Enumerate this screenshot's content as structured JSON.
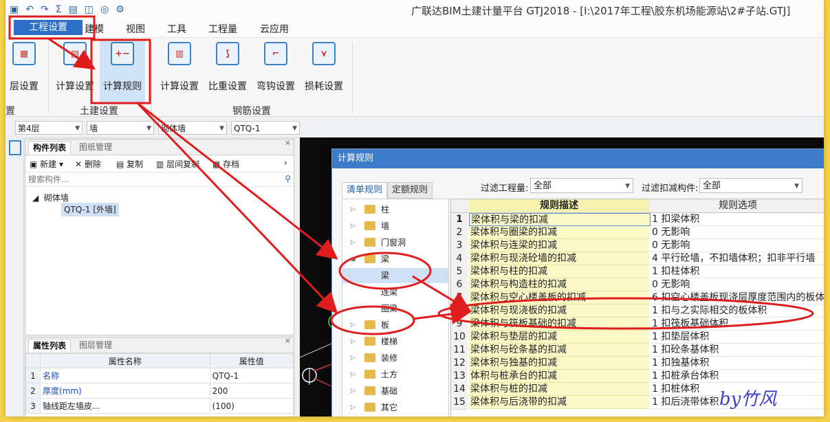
{
  "window": {
    "title": "广联达BIM土建计量平台 GTJ2018 - [I:\\2017年工程\\胶东机场能源站\\2#子站.GTJ]"
  },
  "menu": [
    "工程设置",
    "建模",
    "视图",
    "工具",
    "工程量",
    "云应用"
  ],
  "ribbon": {
    "buttons": [
      "层设置",
      "计算设置",
      "计算规则",
      "计算设置",
      "比重设置",
      "弯钩设置",
      "损耗设置"
    ],
    "groups": [
      "置",
      "土建设置",
      "钢筋设置"
    ]
  },
  "filters": [
    "第4层",
    "墙",
    "砌体墙",
    "QTQ-1"
  ],
  "component_panel": {
    "tabs": [
      "构件列表",
      "图纸管理"
    ],
    "tools": [
      "新建",
      "删除",
      "复制",
      "层间复制",
      "存档"
    ],
    "search_placeholder": "搜索构件...",
    "tree_parent": "砌体墙",
    "tree_child": "QTQ-1 [外墙]"
  },
  "property_panel": {
    "tabs": [
      "属性列表",
      "图层管理"
    ],
    "headers": [
      "属性名称",
      "属性值"
    ],
    "rows": [
      {
        "no": "1",
        "name": "名称",
        "value": "QTQ-1"
      },
      {
        "no": "2",
        "name": "厚度(mm)",
        "value": "200"
      },
      {
        "no": "3",
        "name": "轴线距左墙皮...",
        "value": "(100)"
      }
    ]
  },
  "dialog": {
    "title": "计算规则",
    "tabs": [
      "清单规则",
      "定额规则"
    ],
    "filter_qty_label": "过滤工程量:",
    "filter_qty_value": "全部",
    "filter_comp_label": "过滤扣减构件:",
    "filter_comp_value": "全部",
    "tree": [
      "柱",
      "墙",
      "门窗洞",
      "梁",
      "梁",
      "连梁",
      "圈梁",
      "板",
      "楼梯",
      "装修",
      "土方",
      "基础",
      "其它"
    ],
    "grid_headers": [
      "规则描述",
      "规则选项"
    ],
    "rows": [
      {
        "no": "1",
        "desc": "梁体积与梁的扣减",
        "opt": "1  扣梁体积"
      },
      {
        "no": "2",
        "desc": "梁体积与圈梁的扣减",
        "opt": "0   无影响"
      },
      {
        "no": "3",
        "desc": "梁体积与连梁的扣减",
        "opt": "0   无影响"
      },
      {
        "no": "4",
        "desc": "梁体积与现浇砼墙的扣减",
        "opt": "4  平行砼墙，不扣墙体积；扣非平行墙"
      },
      {
        "no": "5",
        "desc": "梁体积与柱的扣减",
        "opt": "1  扣柱体积"
      },
      {
        "no": "6",
        "desc": "梁体积与构造柱的扣减",
        "opt": "0   无影响"
      },
      {
        "no": "7",
        "desc": "梁体积与空心楼盖板的扣减",
        "opt": "6  扣空心楼盖板现浇层厚度范围内的板体"
      },
      {
        "no": "8",
        "desc": "梁体积与现浇板的扣减",
        "opt": "1  扣与之实际相交的板体积"
      },
      {
        "no": "9",
        "desc": "梁体积与筏板基础的扣减",
        "opt": "1  扣筏板基础体积"
      },
      {
        "no": "10",
        "desc": "梁体积与垫层的扣减",
        "opt": "1  扣垫层体积"
      },
      {
        "no": "11",
        "desc": "梁体积与砼条基的扣减",
        "opt": "1  扣砼条基体积"
      },
      {
        "no": "12",
        "desc": "梁体积与独基的扣减",
        "opt": "1  扣独基体积"
      },
      {
        "no": "13",
        "desc": "体积与桩承台的扣减",
        "opt": "1  扣桩承台体积"
      },
      {
        "no": "14",
        "desc": "梁体积与桩的扣减",
        "opt": "1  扣桩体积"
      },
      {
        "no": "15",
        "desc": "梁体积与后浇带的扣减",
        "opt": "1  扣后浇带体积"
      }
    ]
  },
  "signature": "by竹风"
}
